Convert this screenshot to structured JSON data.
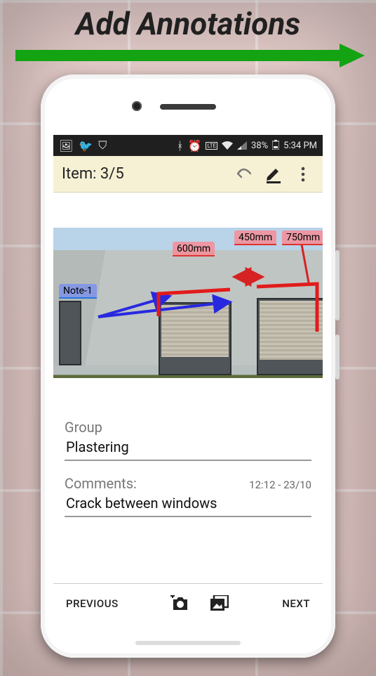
{
  "banner": {
    "title": "Add Annotations"
  },
  "status": {
    "battery": "38%",
    "time": "5:34 PM"
  },
  "appbar": {
    "title": "Item: 3/5"
  },
  "annotations": {
    "note": "Note-1",
    "m600": "600mm",
    "m450": "450mm",
    "m750": "750mm"
  },
  "form": {
    "group_label": "Group",
    "group_value": "Plastering",
    "comments_label": "Comments:",
    "comments_value": "Crack between windows",
    "timestamp": "12:12 - 23/10"
  },
  "nav": {
    "prev": "PREVIOUS",
    "next": "NEXT"
  }
}
